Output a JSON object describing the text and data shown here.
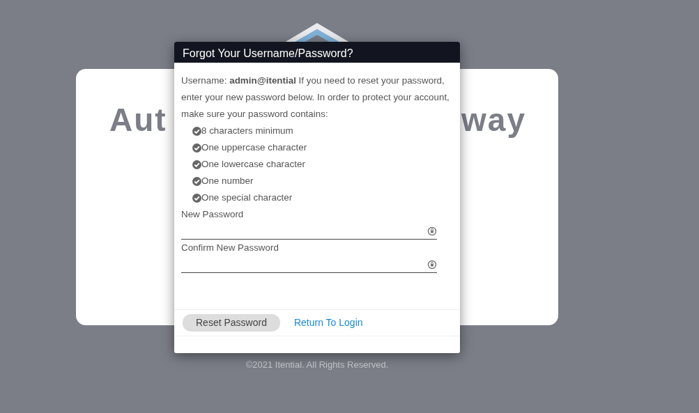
{
  "background_card": {
    "title_parts": [
      "Aut",
      "way"
    ]
  },
  "footer": {
    "copyright": "©2021 Itential. All Rights Reserved."
  },
  "dialog": {
    "title": "Forgot Your Username/Password?",
    "intro": "Username: **admin@itential** If you need to reset your password, enter your new password below. In order to protect your account, make sure your password contains:",
    "requirements": [
      {
        "text": "8 characters minimum",
        "met": true
      },
      {
        "text": "One uppercase character",
        "met": true
      },
      {
        "text": "One lowercase character",
        "met": true
      },
      {
        "text": "One number",
        "met": true
      },
      {
        "text": "One special character",
        "met": true
      }
    ],
    "fields": [
      {
        "label": "New Password"
      },
      {
        "label": "Confirm New Password"
      }
    ],
    "buttons": [
      {
        "kind": "button",
        "label": "Reset Password"
      },
      {
        "kind": "link",
        "label": "Return To Login"
      }
    ]
  }
}
